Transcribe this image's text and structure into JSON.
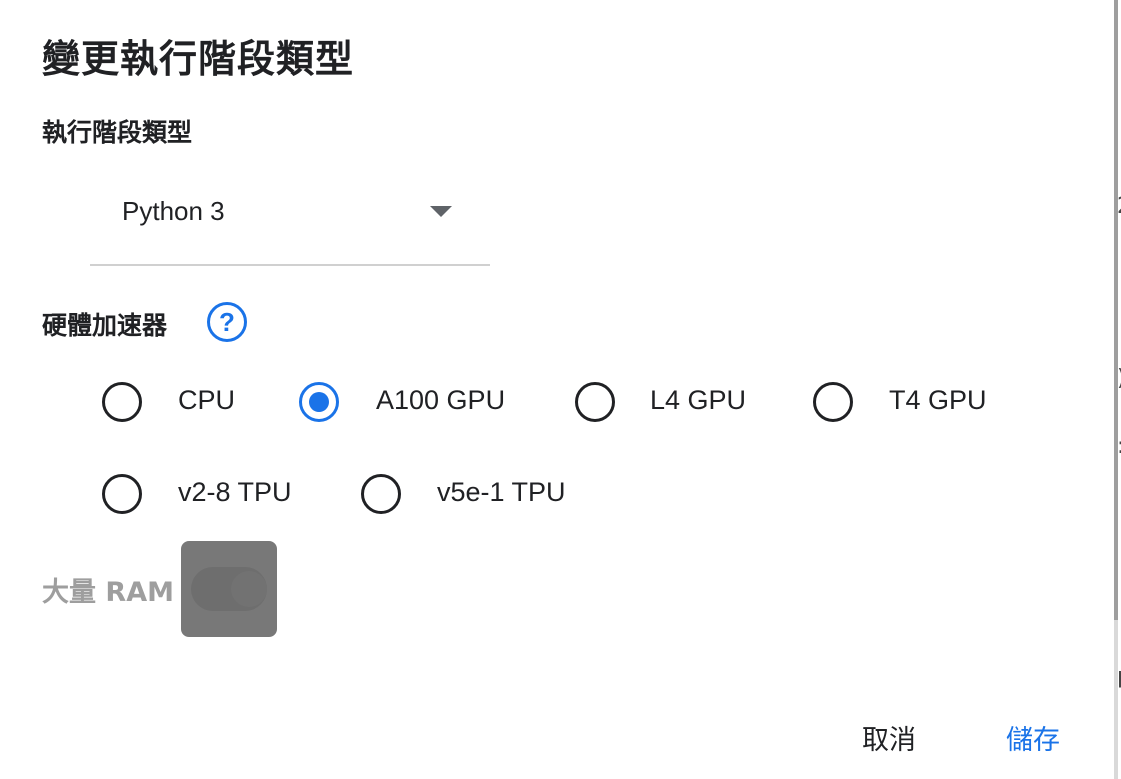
{
  "dialog": {
    "title": "變更執行階段類型",
    "runtime_type": {
      "label": "執行階段類型",
      "selected": "Python 3"
    },
    "accelerator": {
      "label": "硬體加速器",
      "help_icon": "question-circle-icon",
      "selected": "A100 GPU",
      "options": [
        "CPU",
        "A100 GPU",
        "L4 GPU",
        "T4 GPU",
        "v2-8 TPU",
        "v5e-1 TPU"
      ]
    },
    "high_ram": {
      "label": "大量 RAM",
      "enabled": false
    },
    "buttons": {
      "cancel": "取消",
      "save": "儲存"
    }
  },
  "background_fragments": [
    "2",
    ")",
    ":",
    "p"
  ],
  "colors": {
    "accent": "#1a73e8",
    "text": "#202124",
    "disabled": "#9e9e9e"
  }
}
